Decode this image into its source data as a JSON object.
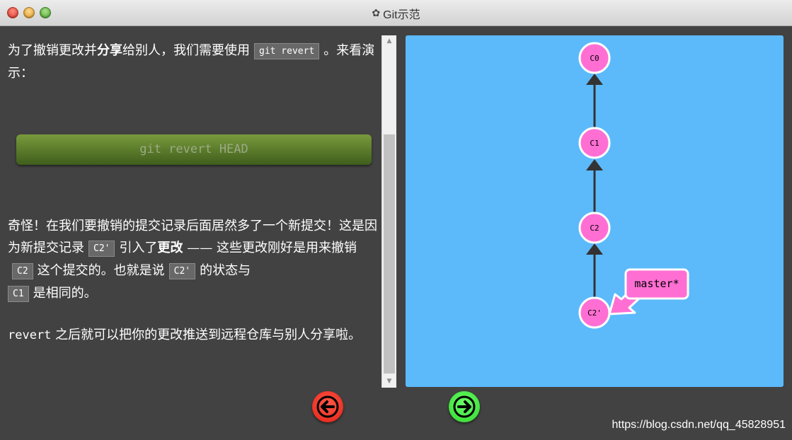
{
  "window": {
    "title": "Git示范",
    "gear_icon": "gear-icon"
  },
  "lesson": {
    "p1_before": "为了撤销更改并",
    "p1_bold": "分享",
    "p1_mid": "给别人，我们需要使用",
    "p1_code": "git revert",
    "p1_after": "。来看演示：",
    "command": "git revert HEAD",
    "p3_a": "奇怪！在我们要撤销的提交记录后面居然多了一个新提交！这是因为新提交记录",
    "p3_code1": "C2'",
    "p3_b": "引入了",
    "p3_bold": "更改",
    "p3_c": "—— 这些更改刚好是用来撤销",
    "p3_code2": "C2",
    "p3_d": "这个提交的。也就是说",
    "p3_code3": "C2'",
    "p3_e": "的状态与",
    "p3_code4": "C1",
    "p3_f": "是相同的。",
    "p4_mono": "revert",
    "p4_text": "之后就可以把你的更改推送到远程仓库与别人分享啦。"
  },
  "graph": {
    "background": "#5cbafb",
    "node_color": "#ff6fd3",
    "commits": [
      {
        "id": "C0",
        "parent": null
      },
      {
        "id": "C1",
        "parent": "C0"
      },
      {
        "id": "C2",
        "parent": "C1"
      },
      {
        "id": "C2'",
        "parent": "C2"
      }
    ],
    "branch": {
      "label": "master*",
      "target": "C2'"
    }
  },
  "nav": {
    "back_icon": "arrow-left-icon",
    "forward_icon": "arrow-right-icon"
  },
  "watermark": "https://blog.csdn.net/qq_45828951"
}
